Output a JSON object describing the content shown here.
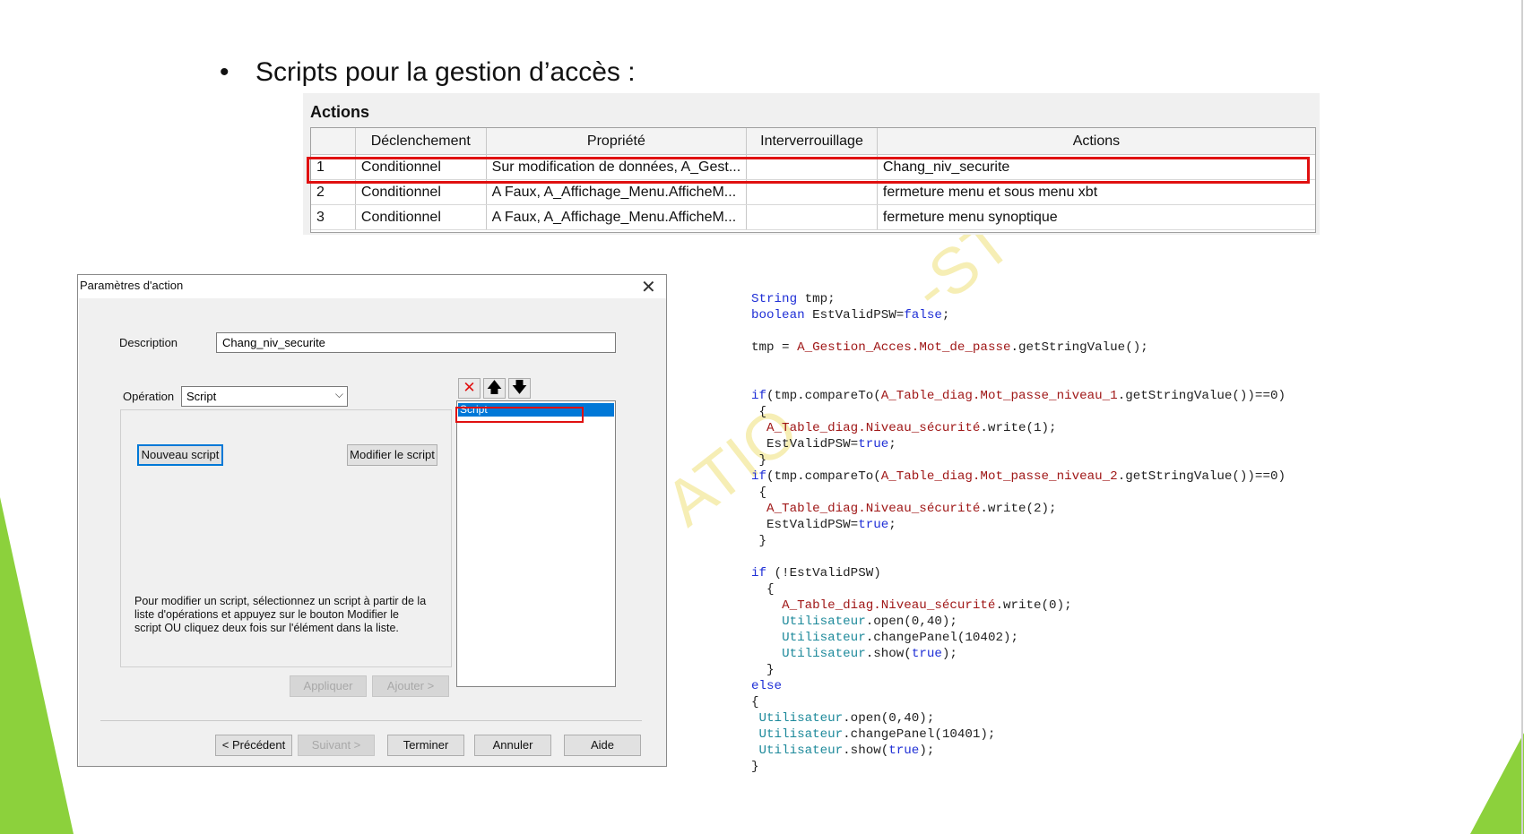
{
  "slide": {
    "bullet_symbol": "•",
    "heading": "Scripts pour la gestion d’accès :"
  },
  "actions_table": {
    "title": "Actions",
    "columns": [
      "",
      "Déclenchement",
      "Propriété",
      "Interverrouillage",
      "Actions"
    ],
    "rows": [
      {
        "num": "1",
        "trigger": "Conditionnel",
        "property": "Sur modification de données, A_Gest...",
        "interlock": "",
        "action": "Chang_niv_securite"
      },
      {
        "num": "2",
        "trigger": "Conditionnel",
        "property": "A Faux, A_Affichage_Menu.AfficheM...",
        "interlock": "",
        "action": "fermeture menu et sous menu xbt"
      },
      {
        "num": "3",
        "trigger": "Conditionnel",
        "property": "A Faux, A_Affichage_Menu.AfficheM...",
        "interlock": "",
        "action": "fermeture menu synoptique"
      }
    ]
  },
  "dialog": {
    "title": "Paramètres d'action",
    "description_label": "Description",
    "description_value": "Chang_niv_securite",
    "operation_label": "Opération",
    "operation_value": "Script",
    "new_script_button": "Nouveau script",
    "edit_script_button": "Modifier le script",
    "help_text": [
      "Pour modifier un script, sélectionnez un script à partir de la",
      "liste d'opérations et appuyez sur le bouton Modifier le",
      "script OU cliquez deux fois sur l'élément dans la liste."
    ],
    "apply_button": "Appliquer",
    "add_button": "Ajouter >",
    "list_items": [
      "Script"
    ],
    "toolbar_icons": [
      "delete-icon",
      "arrow-up-icon",
      "arrow-down-icon"
    ],
    "footer": {
      "previous": "< Précédent",
      "next": "Suivant >",
      "finish": "Terminer",
      "cancel": "Annuler",
      "help": "Aide"
    }
  },
  "code_lines": [
    [
      [
        "kw",
        "String"
      ],
      [
        "plain",
        " tmp;"
      ]
    ],
    [
      [
        "kw",
        "boolean"
      ],
      [
        "plain",
        " EstValidPSW="
      ],
      [
        "kw",
        "false"
      ],
      [
        "plain",
        ";"
      ]
    ],
    [],
    [
      [
        "plain",
        "tmp = "
      ],
      [
        "var",
        "A_Gestion_Acces.Mot_de_passe"
      ],
      [
        "plain",
        ".getStringValue();"
      ]
    ],
    [],
    [],
    [
      [
        "kw",
        "if"
      ],
      [
        "plain",
        "(tmp.compareTo("
      ],
      [
        "var",
        "A_Table_diag.Mot_passe_niveau_1"
      ],
      [
        "plain",
        ".getStringValue())==0)"
      ]
    ],
    [
      [
        "plain",
        " {"
      ]
    ],
    [
      [
        "plain",
        "  "
      ],
      [
        "var",
        "A_Table_diag.Niveau_sécurité"
      ],
      [
        "plain",
        ".write(1);"
      ]
    ],
    [
      [
        "plain",
        "  EstValidPSW="
      ],
      [
        "kw",
        "true"
      ],
      [
        "plain",
        ";"
      ]
    ],
    [
      [
        "plain",
        " }"
      ]
    ],
    [
      [
        "kw",
        "if"
      ],
      [
        "plain",
        "(tmp.compareTo("
      ],
      [
        "var",
        "A_Table_diag.Mot_passe_niveau_2"
      ],
      [
        "plain",
        ".getStringValue())==0)"
      ]
    ],
    [
      [
        "plain",
        " {"
      ]
    ],
    [
      [
        "plain",
        "  "
      ],
      [
        "var",
        "A_Table_diag.Niveau_sécurité"
      ],
      [
        "plain",
        ".write(2);"
      ]
    ],
    [
      [
        "plain",
        "  EstValidPSW="
      ],
      [
        "kw",
        "true"
      ],
      [
        "plain",
        ";"
      ]
    ],
    [
      [
        "plain",
        " }"
      ]
    ],
    [],
    [
      [
        "kw",
        "if"
      ],
      [
        "plain",
        " (!EstValidPSW)"
      ]
    ],
    [
      [
        "plain",
        "  {"
      ]
    ],
    [
      [
        "plain",
        "    "
      ],
      [
        "var",
        "A_Table_diag.Niveau_sécurité"
      ],
      [
        "plain",
        ".write(0);"
      ]
    ],
    [
      [
        "plain",
        "    "
      ],
      [
        "cls",
        "Utilisateur"
      ],
      [
        "plain",
        ".open(0,40);"
      ]
    ],
    [
      [
        "plain",
        "    "
      ],
      [
        "cls",
        "Utilisateur"
      ],
      [
        "plain",
        ".changePanel(10402);"
      ]
    ],
    [
      [
        "plain",
        "    "
      ],
      [
        "cls",
        "Utilisateur"
      ],
      [
        "plain",
        ".show("
      ],
      [
        "kw",
        "true"
      ],
      [
        "plain",
        ");"
      ]
    ],
    [
      [
        "plain",
        "  }"
      ]
    ],
    [
      [
        "kw",
        "else"
      ]
    ],
    [
      [
        "plain",
        "{"
      ]
    ],
    [
      [
        "plain",
        " "
      ],
      [
        "cls",
        "Utilisateur"
      ],
      [
        "plain",
        ".open(0,40);"
      ]
    ],
    [
      [
        "plain",
        " "
      ],
      [
        "cls",
        "Utilisateur"
      ],
      [
        "plain",
        ".changePanel(10401);"
      ]
    ],
    [
      [
        "plain",
        " "
      ],
      [
        "cls",
        "Utilisateur"
      ],
      [
        "plain",
        ".show("
      ],
      [
        "kw",
        "true"
      ],
      [
        "plain",
        ");"
      ]
    ],
    [
      [
        "plain",
        "}"
      ]
    ]
  ],
  "watermark_text": [
    "ATIO",
    "-ST"
  ],
  "colors": {
    "accent_green": "#8cd13c",
    "highlight_red": "#e01010",
    "selection_blue": "#0078d7",
    "keyword_blue": "#1f2fd6",
    "variable_red": "#a01818",
    "class_teal": "#1e8a9b"
  }
}
